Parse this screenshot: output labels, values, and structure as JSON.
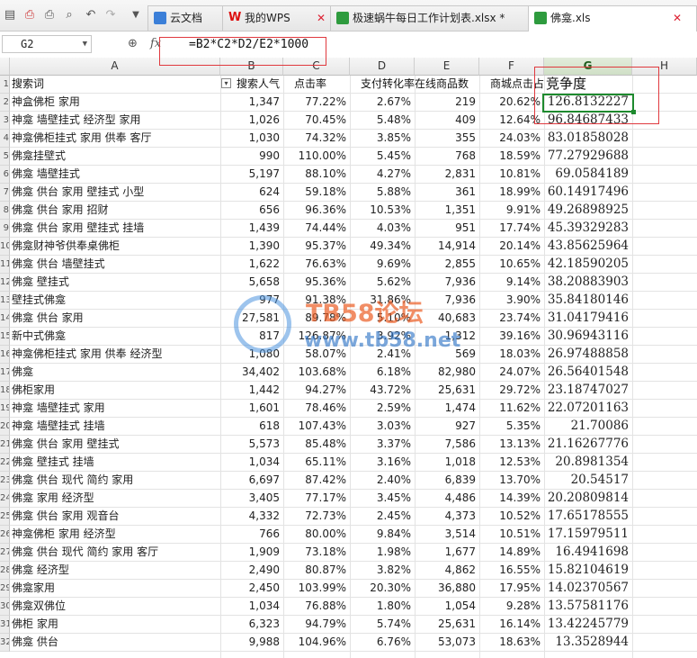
{
  "tabs": [
    {
      "label": "云文档",
      "icon": "cloud-doc-icon",
      "active": false
    },
    {
      "label": "我的WPS",
      "icon": "wps-logo-icon",
      "active": false
    },
    {
      "label": "极速蜗牛每日工作计划表.xlsx *",
      "icon": "spreadsheet-icon",
      "active": false
    },
    {
      "label": "佛龛.xls",
      "icon": "spreadsheet-icon",
      "active": true
    }
  ],
  "formula_bar": {
    "name_box": "G2",
    "fx": "fx",
    "formula": "=B2*C2*D2/E2*1000"
  },
  "columns": [
    "A",
    "B",
    "C",
    "D",
    "E",
    "F",
    "G",
    "H"
  ],
  "header": {
    "A": "搜索词",
    "B": "搜索人气",
    "C": "点击率",
    "D": "支付转化率",
    "E": "在线商品数",
    "F": "商城点击占比",
    "G": "竞争度"
  },
  "row_numbers": [
    "1",
    "2",
    "3",
    "4",
    "5",
    "6",
    "7",
    "8",
    "9",
    "10",
    "11",
    "12",
    "13",
    "14",
    "15",
    "16",
    "17",
    "18",
    "19",
    "20",
    "21",
    "22",
    "23",
    "24",
    "25",
    "26",
    "27",
    "28",
    "29",
    "30",
    "31",
    "32"
  ],
  "rows": [
    [
      "神盒佛柜 家用",
      "1,347",
      "77.22%",
      "2.67%",
      "219",
      "20.62%",
      "126.8132227"
    ],
    [
      "神龛 墙壁挂式 经济型 家用",
      "1,026",
      "70.45%",
      "5.48%",
      "409",
      "12.64%",
      "96.84687433"
    ],
    [
      "神龛佛柜挂式 家用 供奉 客厅",
      "1,030",
      "74.32%",
      "3.85%",
      "355",
      "24.03%",
      "83.01858028"
    ],
    [
      "佛龛挂壁式",
      "990",
      "110.00%",
      "5.45%",
      "768",
      "18.59%",
      "77.27929688"
    ],
    [
      "佛龛 墙壁挂式",
      "5,197",
      "88.10%",
      "4.27%",
      "2,831",
      "10.81%",
      "69.0584189"
    ],
    [
      "佛龛 供台 家用 壁挂式 小型",
      "624",
      "59.18%",
      "5.88%",
      "361",
      "18.99%",
      "60.14917496"
    ],
    [
      "佛龛 供台 家用 招财",
      "656",
      "96.36%",
      "10.53%",
      "1,351",
      "9.91%",
      "49.26898925"
    ],
    [
      "佛龛 供台 家用 壁挂式 挂墙",
      "1,439",
      "74.44%",
      "4.03%",
      "951",
      "17.74%",
      "45.39329283"
    ],
    [
      "佛龛财神爷供奉桌佛柜",
      "1,390",
      "95.37%",
      "49.34%",
      "14,914",
      "20.14%",
      "43.85625964"
    ],
    [
      "佛龛 供台 墙壁挂式",
      "1,622",
      "76.63%",
      "9.69%",
      "2,855",
      "10.65%",
      "42.18590205"
    ],
    [
      "佛龛 壁挂式",
      "5,658",
      "95.36%",
      "5.62%",
      "7,936",
      "9.14%",
      "38.20883903"
    ],
    [
      "壁挂式佛龛",
      "977",
      "91.38%",
      "31.86%",
      "7,936",
      "3.90%",
      "35.84180146"
    ],
    [
      "佛龛 供台 家用",
      "27,581",
      "89.78%",
      "5.10%",
      "40,683",
      "23.74%",
      "31.04179416"
    ],
    [
      "新中式佛龛",
      "817",
      "126.87%",
      "3.92%",
      "1,312",
      "39.16%",
      "30.96943116"
    ],
    [
      "神龛佛柜挂式 家用 供奉 经济型",
      "1,080",
      "58.07%",
      "2.41%",
      "569",
      "18.03%",
      "26.97488858"
    ],
    [
      "佛龛",
      "34,402",
      "103.68%",
      "6.18%",
      "82,980",
      "24.07%",
      "26.56401548"
    ],
    [
      "佛柜家用",
      "1,442",
      "94.27%",
      "43.72%",
      "25,631",
      "29.72%",
      "23.18747027"
    ],
    [
      "神龛 墙壁挂式 家用",
      "1,601",
      "78.46%",
      "2.59%",
      "1,474",
      "11.62%",
      "22.07201163"
    ],
    [
      "神龛 墙壁挂式 挂墙",
      "618",
      "107.43%",
      "3.03%",
      "927",
      "5.35%",
      "21.70086"
    ],
    [
      "佛龛 供台 家用 壁挂式",
      "5,573",
      "85.48%",
      "3.37%",
      "7,586",
      "13.13%",
      "21.16267776"
    ],
    [
      "佛龛 壁挂式 挂墙",
      "1,034",
      "65.11%",
      "3.16%",
      "1,018",
      "12.53%",
      "20.8981354"
    ],
    [
      "佛龛 供台 现代 简约 家用",
      "6,697",
      "87.42%",
      "2.40%",
      "6,839",
      "13.70%",
      "20.54517"
    ],
    [
      "佛龛 家用 经济型",
      "3,405",
      "77.17%",
      "3.45%",
      "4,486",
      "14.39%",
      "20.20809814"
    ],
    [
      "佛龛 供台 家用 观音台",
      "4,332",
      "72.73%",
      "2.45%",
      "4,373",
      "10.52%",
      "17.65178555"
    ],
    [
      "神龛佛柜 家用 经济型",
      "766",
      "80.00%",
      "9.84%",
      "3,514",
      "10.51%",
      "17.15979511"
    ],
    [
      "佛龛 供台 现代 简约 家用 客厅",
      "1,909",
      "73.18%",
      "1.98%",
      "1,677",
      "14.89%",
      "16.4941698"
    ],
    [
      "佛龛 经济型",
      "2,490",
      "80.87%",
      "3.82%",
      "4,862",
      "16.55%",
      "15.82104619"
    ],
    [
      "佛龛家用",
      "2,450",
      "103.99%",
      "20.30%",
      "36,880",
      "17.95%",
      "14.02370567"
    ],
    [
      "佛龛双佛位",
      "1,034",
      "76.88%",
      "1.80%",
      "1,054",
      "9.28%",
      "13.57581176"
    ],
    [
      "佛柜 家用",
      "6,323",
      "94.79%",
      "5.74%",
      "25,631",
      "16.14%",
      "13.42245779"
    ],
    [
      "佛龛 供台",
      "9,988",
      "104.96%",
      "6.76%",
      "53,073",
      "18.63%",
      "13.3528944"
    ]
  ],
  "watermark": {
    "title": "TB58论坛",
    "url": "www.tb58.net"
  },
  "colors": {
    "selection": "#1e8a2e",
    "annotation": "#e0393e",
    "watermark_orange": "#eb5d23",
    "watermark_blue": "#3478c8"
  }
}
